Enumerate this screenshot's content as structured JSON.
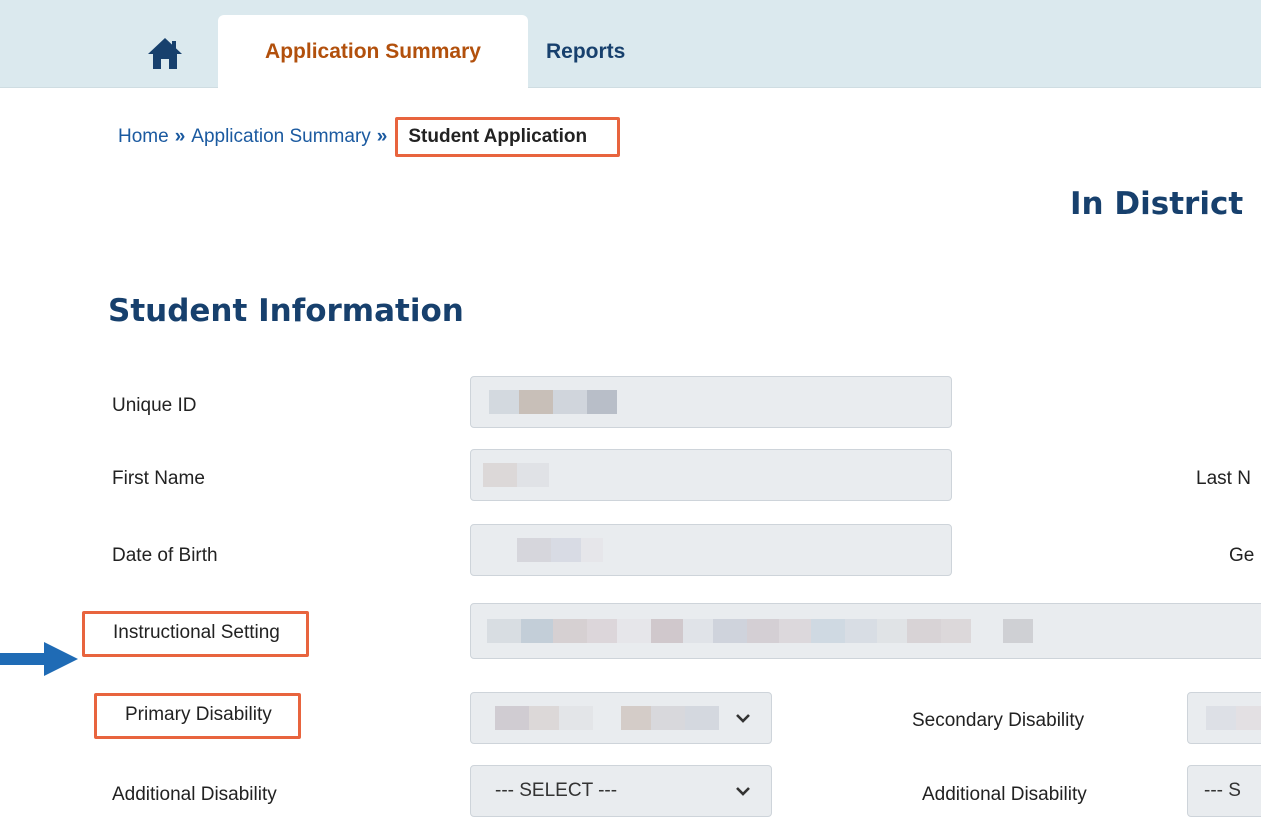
{
  "nav": {
    "home_icon": "home-icon",
    "tabs": [
      {
        "label": "Application Summary",
        "active": true
      },
      {
        "label": "Reports",
        "active": false
      }
    ],
    "accent_color": "#b2500c",
    "navy_color": "#17406d",
    "highlight_color": "#e8643e"
  },
  "breadcrumb": {
    "home": "Home",
    "separator": "»",
    "app_summary": "Application Summary",
    "current": "Student Application"
  },
  "page_title": "In District",
  "section_title": "Student Information",
  "fields": {
    "unique_id": {
      "label": "Unique ID"
    },
    "first_name": {
      "label": "First Name"
    },
    "last_name": {
      "label": "Last N"
    },
    "dob": {
      "label": "Date of Birth"
    },
    "gender": {
      "label": "Ge"
    },
    "instructional_setting": {
      "label": "Instructional Setting"
    },
    "primary_disability": {
      "label": "Primary Disability"
    },
    "secondary_disability": {
      "label": "Secondary Disability"
    },
    "additional_disability_1": {
      "label": "Additional Disability",
      "value": "--- SELECT ---"
    },
    "additional_disability_2": {
      "label": "Additional Disability",
      "value": "--- S"
    }
  }
}
